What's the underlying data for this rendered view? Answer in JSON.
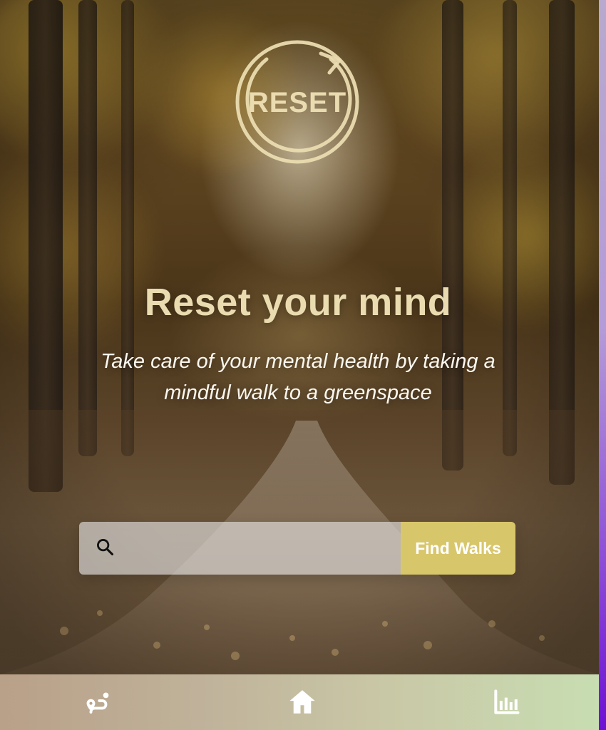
{
  "logo": {
    "text": "RESET",
    "icon": "reset-logo-icon",
    "color": "#eadcb0"
  },
  "hero": {
    "title": "Reset your mind",
    "subtitle": "Take care of your mental health by taking a mindful walk to a greenspace"
  },
  "search": {
    "value": "",
    "placeholder": "",
    "icon": "search-icon",
    "button_label": "Find Walks",
    "button_color": "#d8c66b"
  },
  "bottom_nav": {
    "items": [
      {
        "id": "route",
        "icon": "route-icon"
      },
      {
        "id": "home",
        "icon": "home-icon"
      },
      {
        "id": "stats",
        "icon": "bar-chart-icon"
      }
    ],
    "icon_color": "#ffffff"
  },
  "theme": {
    "accent": "#d8c66b",
    "text_light": "#fbf7ef"
  }
}
